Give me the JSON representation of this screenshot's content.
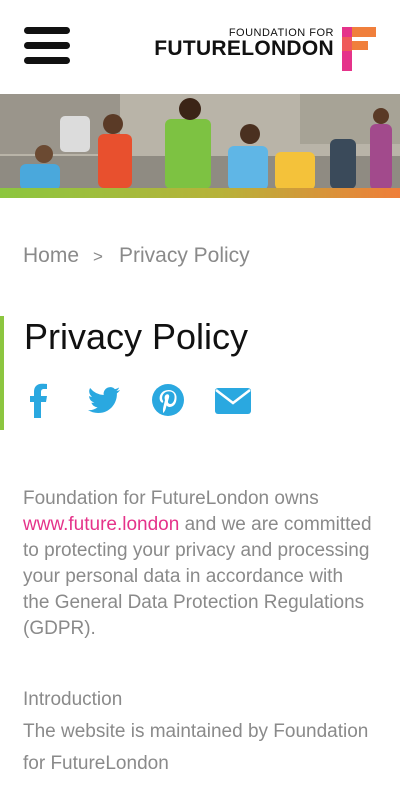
{
  "header": {
    "menu_label": "Menu",
    "logo_small": "FOUNDATION FOR",
    "logo_big": "FUTURELONDON"
  },
  "hero": {
    "alt": "Children playing outdoors"
  },
  "breadcrumb": {
    "home": "Home",
    "separator": ">",
    "current": "Privacy Policy"
  },
  "page": {
    "title": "Privacy Policy"
  },
  "share": {
    "icons": [
      "facebook-icon",
      "twitter-icon",
      "pinterest-icon",
      "email-icon"
    ],
    "color": "#2aa8e0"
  },
  "content": {
    "intro_before": "Foundation for FutureLondon owns ",
    "intro_link": "www.future.london",
    "intro_after": " and we are committed to protecting your privacy and processing your personal data in accordance with the General Data Protection Regulations (GDPR).",
    "section_heading": "Introduction",
    "section_text": "The website is maintained by Foundation for FutureLondon"
  },
  "colors": {
    "accent_green": "#8cc63f",
    "link_pink": "#e5338a",
    "text_gray": "#8a8a8a"
  }
}
